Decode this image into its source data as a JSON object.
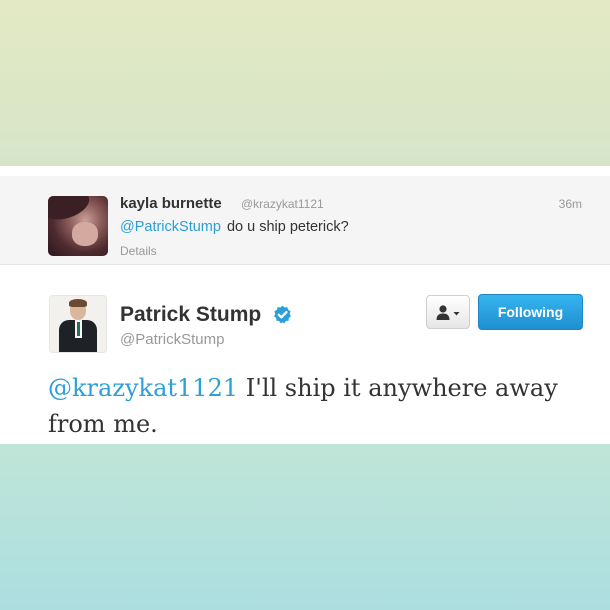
{
  "reply": {
    "name": "kayla burnette",
    "handle": "@krazykat1121",
    "time": "36m",
    "mention": "@PatrickStump",
    "text": "do u ship peterick?",
    "details_label": "Details"
  },
  "tweet": {
    "name": "Patrick Stump",
    "handle": "@PatrickStump",
    "mention": "@krazykat1121",
    "text": "I'll ship it anywhere away from me."
  },
  "actions": {
    "following_label": "Following"
  },
  "colors": {
    "link": "#2b9fd6",
    "button_blue": "#1e8fd1",
    "verified": "#2a9fd9",
    "text": "#333333",
    "muted": "#999999"
  },
  "icons": {
    "verified": "verified-badge-icon",
    "user_menu": "user-icon",
    "dropdown": "caret-down-icon"
  }
}
